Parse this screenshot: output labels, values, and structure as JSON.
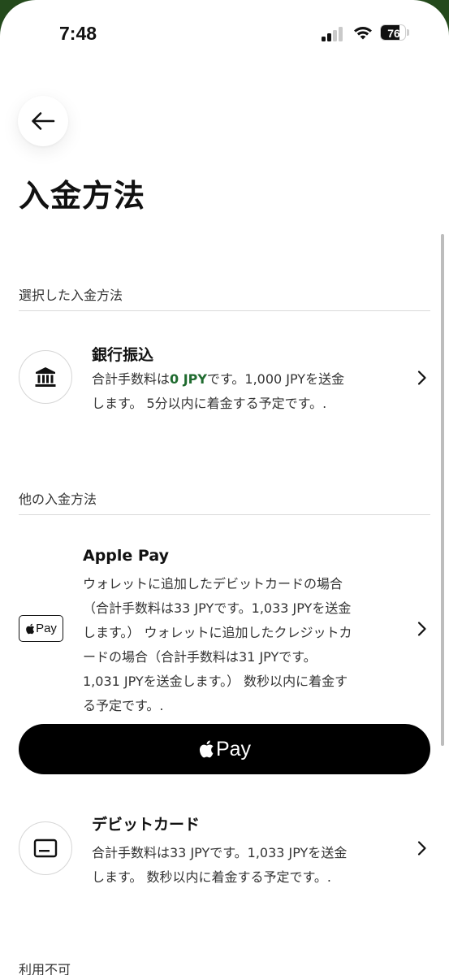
{
  "status_bar": {
    "time": "7:48",
    "battery": "76",
    "battery_level": 0.76
  },
  "header": {
    "title": "入金方法"
  },
  "selected_section": {
    "label": "選択した入金方法",
    "method": {
      "title": "銀行振込",
      "icon": "bank-icon",
      "desc_line1_prefix": "合計手数料は",
      "desc_line1_fee": "0 JPY",
      "desc_line1_suffix": "です。1,000 JPYを送金",
      "desc_line2": "します。 5分以内に着金する予定です。."
    }
  },
  "other_section": {
    "label": "他の入金方法",
    "apple_pay": {
      "title": "Apple Pay",
      "badge_label": "Pay",
      "lines": [
        "ウォレットに追加したデビットカードの場合",
        "（合計手数料は33 JPYです。1,033 JPYを送金",
        "します。） ウォレットに追加したクレジットカ",
        "ードの場合（合計手数料は31 JPYです。",
        "1,031 JPYを送金します。） 数秒以内に着金す",
        "る予定です。."
      ],
      "button_label": "Pay"
    },
    "debit_card": {
      "title": "デビットカード",
      "icon": "card-icon",
      "line1": "合計手数料は33 JPYです。1,033 JPYを送金",
      "line2": "します。 数秒以内に着金する予定です。."
    }
  },
  "unavailable_section": {
    "label": "利用不可"
  },
  "colors": {
    "frame": "#244a1c",
    "accent_green": "#1f6b2f",
    "button_black": "#000000"
  }
}
